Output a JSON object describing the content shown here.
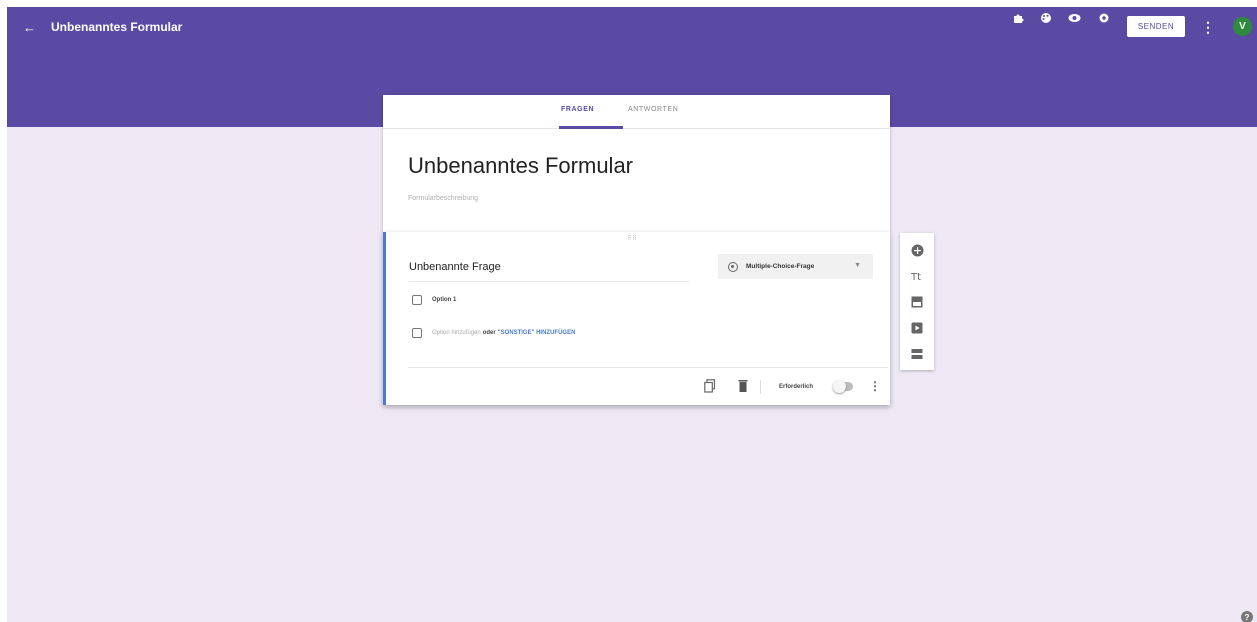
{
  "header": {
    "form_title": "Unbenanntes Formular",
    "send_label": "SENDEN",
    "avatar_letter": "V",
    "icons": [
      "puzzle-icon",
      "palette-icon",
      "eye-icon",
      "gear-icon",
      "more-vert-icon"
    ]
  },
  "tabs": {
    "questions": "FRAGEN",
    "answers": "ANTWORTEN"
  },
  "form": {
    "title": "Unbenanntes Formular",
    "description_placeholder": "Formularbeschreibung"
  },
  "question": {
    "title": "Unbenannte Frage",
    "type_label": "Multiple-Choice-Frage",
    "options": [
      "Option 1"
    ],
    "add_option_label": "Option hinzufügen",
    "add_option_or": "oder",
    "add_other_label": "\"SONSTIGE\" HINZUFÜGEN",
    "required_label": "Erforderlich"
  },
  "colors": {
    "brand": "#5b4aa3",
    "accent_blue": "#4a7bd1",
    "background": "#ede8f4"
  }
}
